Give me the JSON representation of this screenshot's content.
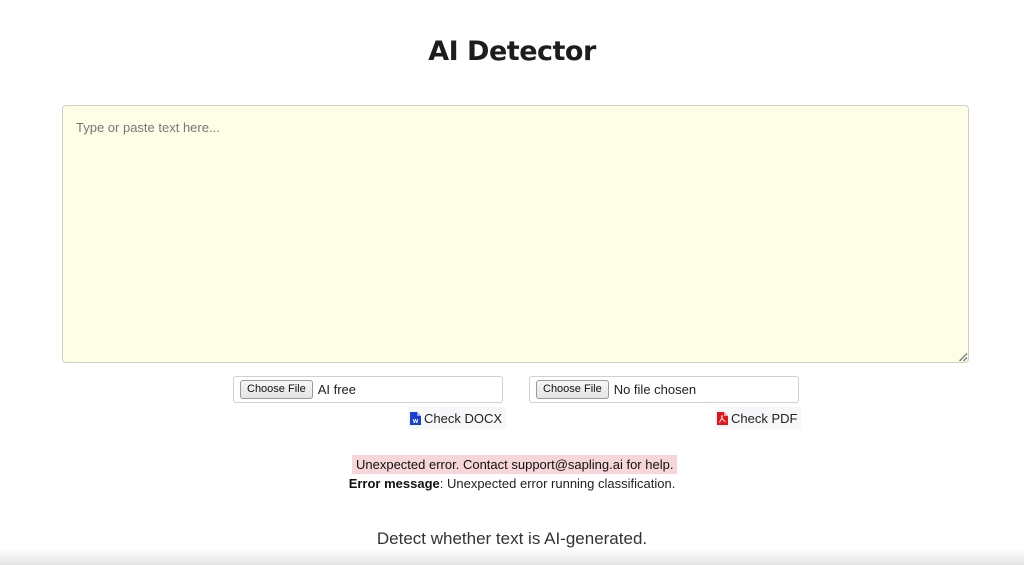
{
  "header": {
    "title": "AI Detector"
  },
  "editor": {
    "placeholder": "Type or paste text here...",
    "value": "",
    "background_color": "#fefee6"
  },
  "upload": {
    "docx": {
      "choose_label": "Choose File",
      "file_name": "AI free",
      "check_label": "Check DOCX",
      "icon": "word-file-icon",
      "icon_color": "#1a3fd6"
    },
    "pdf": {
      "choose_label": "Choose File",
      "file_name": "No file chosen",
      "check_label": "Check PDF",
      "icon": "pdf-file-icon",
      "icon_color": "#e3141b"
    }
  },
  "error": {
    "banner": "Unexpected error. Contact support@sapling.ai for help.",
    "message_label": "Error message",
    "message_text": ": Unexpected error running classification.",
    "banner_color": "#f6d6d8"
  },
  "footer": {
    "tagline": "Detect whether text is AI-generated."
  }
}
